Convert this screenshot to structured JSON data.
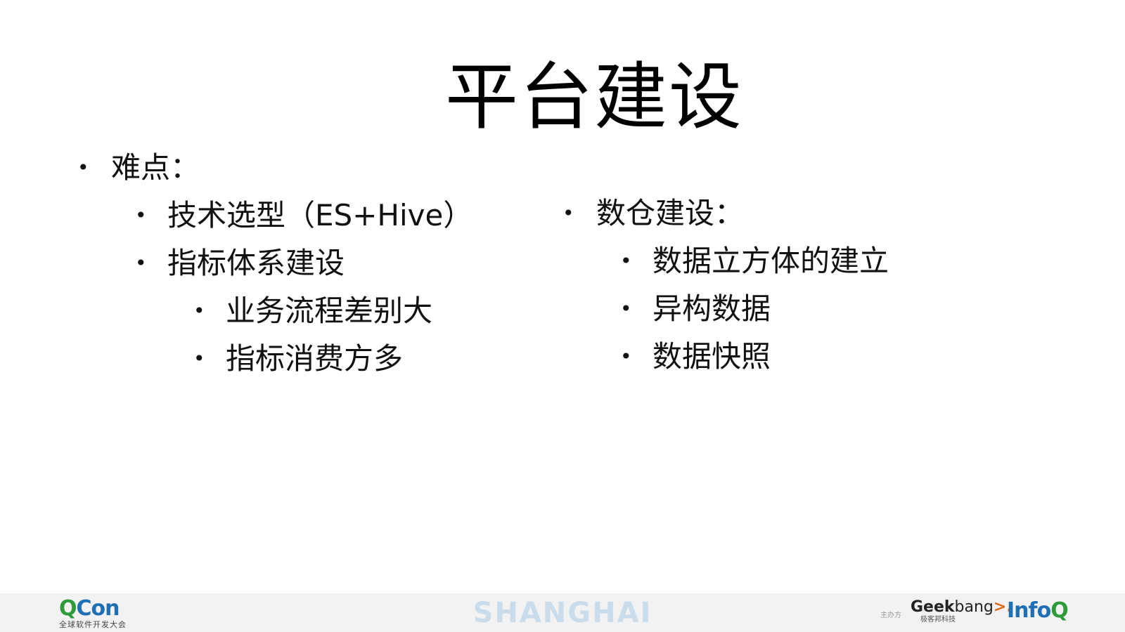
{
  "slide": {
    "title": "平台建设",
    "left_column": {
      "heading": "难点：",
      "items": [
        {
          "label": "技术选型（ES+Hive）"
        },
        {
          "label": "指标体系建设",
          "children": [
            {
              "label": "业务流程差别大"
            },
            {
              "label": "指标消费方多"
            }
          ]
        }
      ]
    },
    "right_column": {
      "heading": "数仓建设：",
      "items": [
        {
          "label": "数据立方体的建立"
        },
        {
          "label": "异构数据"
        },
        {
          "label": "数据快照"
        }
      ]
    },
    "bullet_glyph": "•"
  },
  "footer": {
    "qcon_q": "Q",
    "qcon_con": "Con",
    "qcon_subtitle": "全球软件开发大会",
    "city": "SHANGHAI",
    "host_label": "主办方",
    "geek_text": "Geek",
    "geek_bang": "bang",
    "geek_arrow": ">.",
    "geek_subtitle": "极客邦科技",
    "infoq_info": "Info",
    "infoq_q": "Q",
    "colors": {
      "qcon_green": "#2e9a3a",
      "qcon_blue": "#1f6fb5",
      "city_color": "#c9dcec",
      "geek_orange": "#e06a1b",
      "footer_bg": "#f2f2f2"
    }
  }
}
